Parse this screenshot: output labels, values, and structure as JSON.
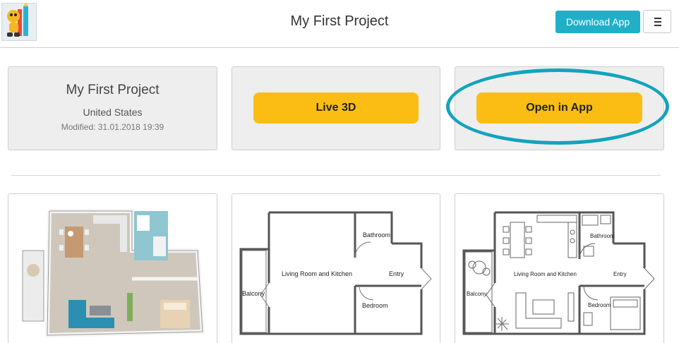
{
  "header": {
    "title": "My First Project",
    "download_label": "Download App",
    "menu_icon": "hamburger-icon",
    "logo_icon": "pencil-character-logo"
  },
  "project": {
    "name": "My First Project",
    "country": "United States",
    "modified": "Modified: 31.01.2018 19:39"
  },
  "actions": {
    "live3d_label": "Live 3D",
    "open_app_label": "Open in App"
  },
  "highlight_color": "#13a3bd",
  "accent_color": "#1fb0c8",
  "button_color": "#fbbd14",
  "floorplans": {
    "thumb1": "3d-floorplan-render",
    "plan2": {
      "bathroom": "Bathroom",
      "living": "Living Room and Kitchen",
      "entry": "Entry",
      "balcony": "Balcony",
      "bedroom": "Bedroom"
    },
    "plan3": {
      "bathroom": "Bathroom",
      "living": "Living Room and Kitchen",
      "entry": "Entry",
      "balcony": "Balcony",
      "bedroom": "Bedroom"
    }
  }
}
